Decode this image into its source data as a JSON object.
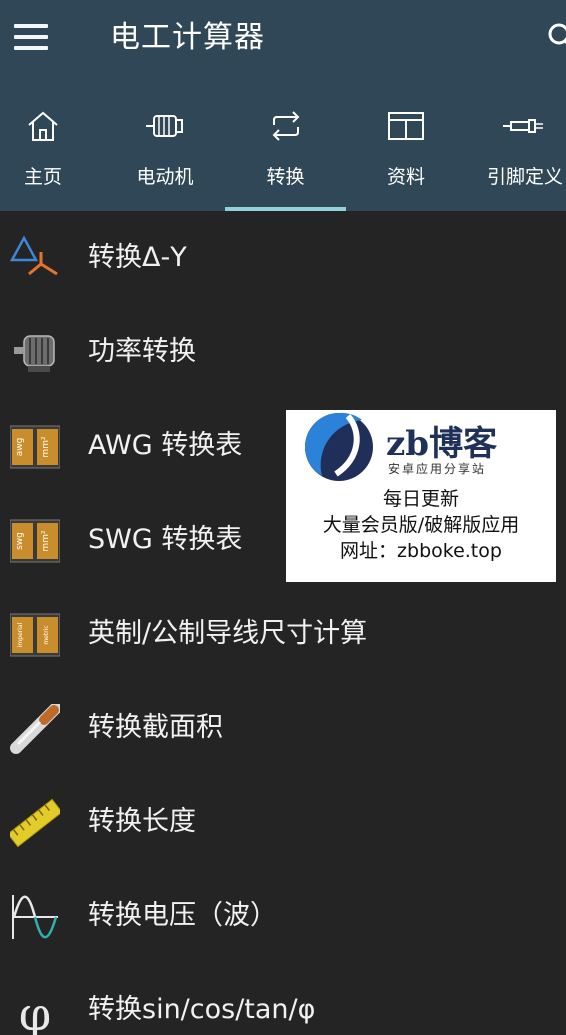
{
  "app": {
    "title": "电工计算器"
  },
  "tabs": [
    {
      "label": "主页",
      "icon": "home-icon"
    },
    {
      "label": "电动机",
      "icon": "motor-icon"
    },
    {
      "label": "转换",
      "icon": "convert-icon",
      "active": true
    },
    {
      "label": "资料",
      "icon": "book-icon"
    },
    {
      "label": "引脚定义",
      "icon": "connector-icon"
    }
  ],
  "items": [
    {
      "label": "转换Δ-Y",
      "icon": "delta-star-icon"
    },
    {
      "label": "功率转换",
      "icon": "motor-photo-icon"
    },
    {
      "label": "AWG 转换表",
      "icon": "awg-mm2-icon"
    },
    {
      "label": "SWG 转换表",
      "icon": "swg-mm2-icon"
    },
    {
      "label": "英制/公制导线尺寸计算",
      "icon": "imperial-metric-icon"
    },
    {
      "label": "转换截面积",
      "icon": "cable-icon"
    },
    {
      "label": "转换长度",
      "icon": "ruler-icon"
    },
    {
      "label": "转换电压（波）",
      "icon": "sine-wave-icon"
    },
    {
      "label": "转换sin/cos/tan/φ",
      "icon": "phi-icon"
    }
  ],
  "icon_text": {
    "awg": "awg",
    "swg": "swg",
    "mm2": "mm²",
    "imperial": "imperial",
    "metric": "metric",
    "phi": "φ"
  },
  "ad": {
    "brand": "zb博客",
    "subtitle": "安卓应用分享站",
    "line1": "每日更新",
    "line2": "大量会员版/破解版应用",
    "line3": "网址：zbboke.top"
  },
  "colors": {
    "appbar": "#2f4756",
    "background": "#242424",
    "accent": "#8fd2de"
  }
}
